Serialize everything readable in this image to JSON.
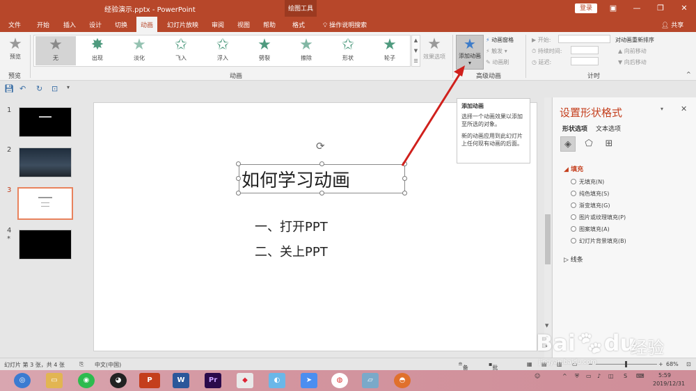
{
  "window": {
    "title": "经验演示.pptx  -  PowerPoint",
    "context_group": "绘图工具",
    "login": "登录"
  },
  "tabs": [
    "文件",
    "开始",
    "插入",
    "设计",
    "切换",
    "动画",
    "幻灯片放映",
    "审阅",
    "视图",
    "帮助",
    "格式"
  ],
  "active_tab": "动画",
  "search_tab": "操作说明搜索",
  "share": "共享",
  "ribbon": {
    "preview": {
      "label": "预览",
      "group": "预览"
    },
    "animations": [
      "无",
      "出现",
      "淡化",
      "飞入",
      "浮入",
      "劈裂",
      "擦除",
      "形状",
      "轮子"
    ],
    "selected_animation": "无",
    "effect_options": "效果选项",
    "animation_group": "动画",
    "advanced": {
      "add_animation": "添加动画",
      "pane": "动画窗格",
      "trigger": "触发",
      "painter": "动画刷",
      "group": "高级动画"
    },
    "timing": {
      "start": "开始:",
      "duration": "持续时间:",
      "delay": "延迟:",
      "reorder": "对动画重新排序",
      "move_earlier": "向前移动",
      "move_later": "向后移动",
      "group": "计时"
    }
  },
  "thumbnails": [
    {
      "num": "1"
    },
    {
      "num": "2"
    },
    {
      "num": "3"
    },
    {
      "num": "4",
      "mark": "*"
    }
  ],
  "slide": {
    "title": "如何学习动画",
    "bullets": [
      "一、打开PPT",
      "二、关上PPT"
    ]
  },
  "tooltip": {
    "title": "添加动画",
    "line1": "选择一个动画效果以添加至所选的对象。",
    "line2": "新的动画应用到此幻灯片上任何现有动画的后面。"
  },
  "panel": {
    "title": "设置形状格式",
    "tabs": [
      "形状选项",
      "文本选项"
    ],
    "fill_section": "填充",
    "fill_options": [
      "无填充(N)",
      "纯色填充(S)",
      "渐变填充(G)",
      "图片或纹理填充(P)",
      "图案填充(A)",
      "幻灯片背景填充(B)"
    ],
    "line_section": "线条"
  },
  "status": {
    "slide_info": "幻灯片 第 3 张，共 4 张",
    "language": "中文(中国)",
    "notes": "备注",
    "comments": "批注",
    "zoom": "68%"
  },
  "tray": {
    "time": "5:59",
    "date": "2019/12/31"
  },
  "watermark": {
    "brand": "Bai",
    "brand2": "du",
    "cn": "经验",
    "url": "jingyan.baidu.com"
  },
  "colors": {
    "accent": "#b7472a",
    "highlight": "#c43e1c",
    "arrow": "#d0201c"
  }
}
